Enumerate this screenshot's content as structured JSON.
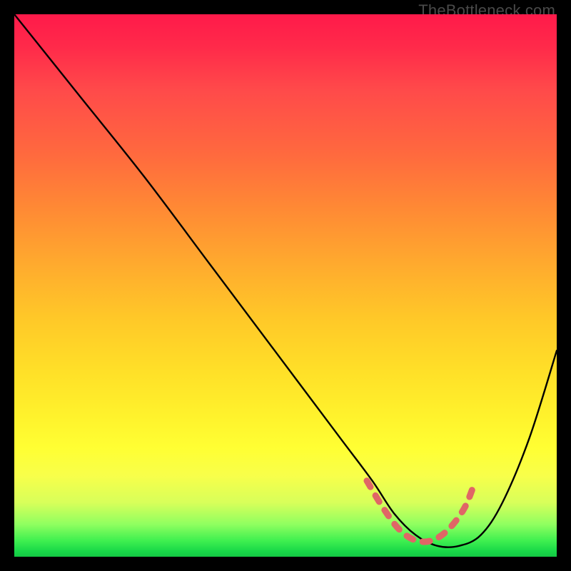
{
  "watermark": "TheBottleneck.com",
  "chart_data": {
    "type": "line",
    "title": "",
    "xlabel": "",
    "ylabel": "",
    "xlim": [
      0,
      100
    ],
    "ylim": [
      0,
      100
    ],
    "series": [
      {
        "name": "curve",
        "x": [
          0,
          12,
          24,
          36,
          48,
          60,
          66,
          70,
          74,
          78,
          82,
          86,
          90,
          95,
          100
        ],
        "values": [
          100,
          85,
          70,
          54,
          38,
          22,
          14,
          8,
          4,
          2,
          2,
          4,
          10,
          22,
          38
        ]
      }
    ],
    "highlight": {
      "x": [
        65,
        68,
        71,
        74,
        77,
        80,
        83,
        85
      ],
      "values": [
        14,
        9,
        5,
        3,
        3,
        5,
        9,
        14
      ]
    },
    "colors": {
      "curve": "#000000",
      "highlight": "#e06666",
      "background_top": "#ff1a4a",
      "background_bottom": "#14c844"
    }
  }
}
